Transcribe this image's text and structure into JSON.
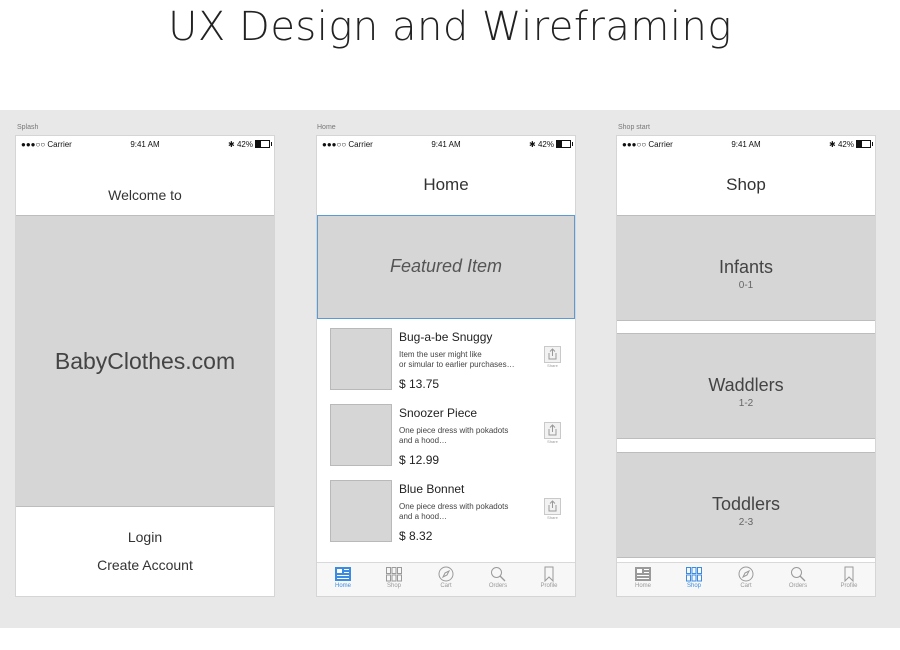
{
  "page": {
    "title": "UX Design and Wireframing"
  },
  "status_bar": {
    "carrier": "●●●○○ Carrier",
    "time": "9:41 AM",
    "battery": "42%"
  },
  "artboards": {
    "splash": {
      "label": "Splash",
      "welcome": "Welcome to",
      "brand": "BabyClothes.com",
      "login": "Login",
      "create_account": "Create Account"
    },
    "home": {
      "label": "Home",
      "title": "Home",
      "featured": "Featured Item",
      "share_label": "Share",
      "products": [
        {
          "name": "Bug-a-be Snuggy",
          "desc1": "Item the user might like",
          "desc2": "or simular to earlier purchases…",
          "price": "$ 13.75"
        },
        {
          "name": "Snoozer Piece",
          "desc1": "One piece dress with pokadots",
          "desc2": "and a hood…",
          "price": "$ 12.99"
        },
        {
          "name": "Blue Bonnet",
          "desc1": "One piece dress with pokadots",
          "desc2": "and a hood…",
          "price": "$ 8.32"
        }
      ]
    },
    "shop": {
      "label": "Shop start",
      "title": "Shop",
      "categories": [
        {
          "name": "Infants",
          "range": "0-1"
        },
        {
          "name": "Waddlers",
          "range": "1-2"
        },
        {
          "name": "Toddlers",
          "range": "2-3"
        }
      ]
    }
  },
  "tabbar": {
    "items": [
      {
        "label": "Home",
        "icon": "home-icon"
      },
      {
        "label": "Shop",
        "icon": "grid-icon"
      },
      {
        "label": "Cart",
        "icon": "compass-icon"
      },
      {
        "label": "Orders",
        "icon": "search-icon"
      },
      {
        "label": "Profile",
        "icon": "bookmark-icon"
      }
    ],
    "active_color": "#3b8be0",
    "inactive_color": "#9a9a9a"
  },
  "colors": {
    "placeholder_gray": "#d6d6d6",
    "featured_border": "#5b9bd5",
    "canvas": "#e8e8e8"
  }
}
